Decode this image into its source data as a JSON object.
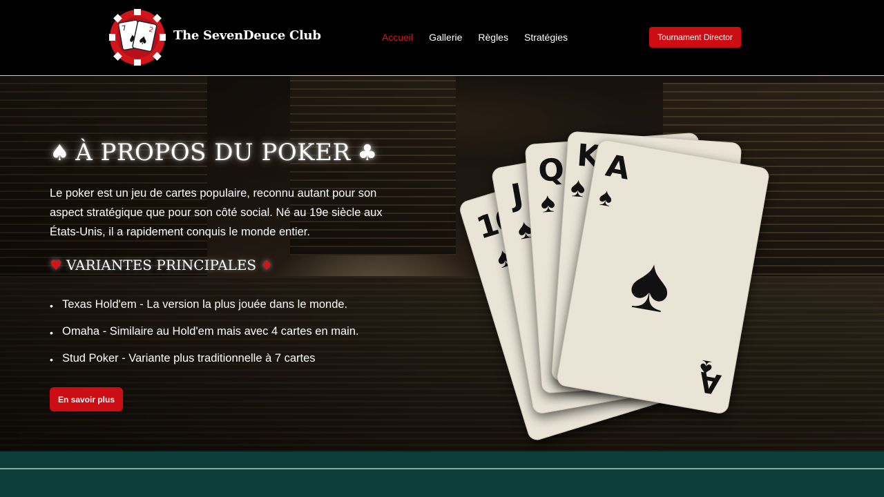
{
  "header": {
    "brand": "The SevenDeuce Club",
    "nav": [
      "Accueil",
      "Gallerie",
      "Règles",
      "Stratégies"
    ],
    "cta": "Tournament Director"
  },
  "hero": {
    "title": "À PROPOS DU POKER",
    "intro": "Le poker est un jeu de cartes populaire, reconnu autant pour son aspect stratégique que pour son côté social. Né au 19e siècle aux États-Unis, il a rapidement conquis le monde entier.",
    "subtitle": "VARIANTES PRINCIPALES",
    "variants": [
      "Texas Hold'em - La version la plus jouée dans le monde.",
      "Omaha - Similaire au Hold'em mais avec 4 cartes en main.",
      "Stud Poker - Variante plus traditionnelle à 7 cartes"
    ],
    "button": "En savoir plus"
  },
  "cards": [
    "10",
    "J",
    "Q",
    "K",
    "A"
  ],
  "icons": {
    "spade": "♠",
    "club": "♣",
    "heart": "♥",
    "diamond": "♦"
  },
  "colors": {
    "accent": "#cc0d14",
    "band": "#0c3f39"
  }
}
